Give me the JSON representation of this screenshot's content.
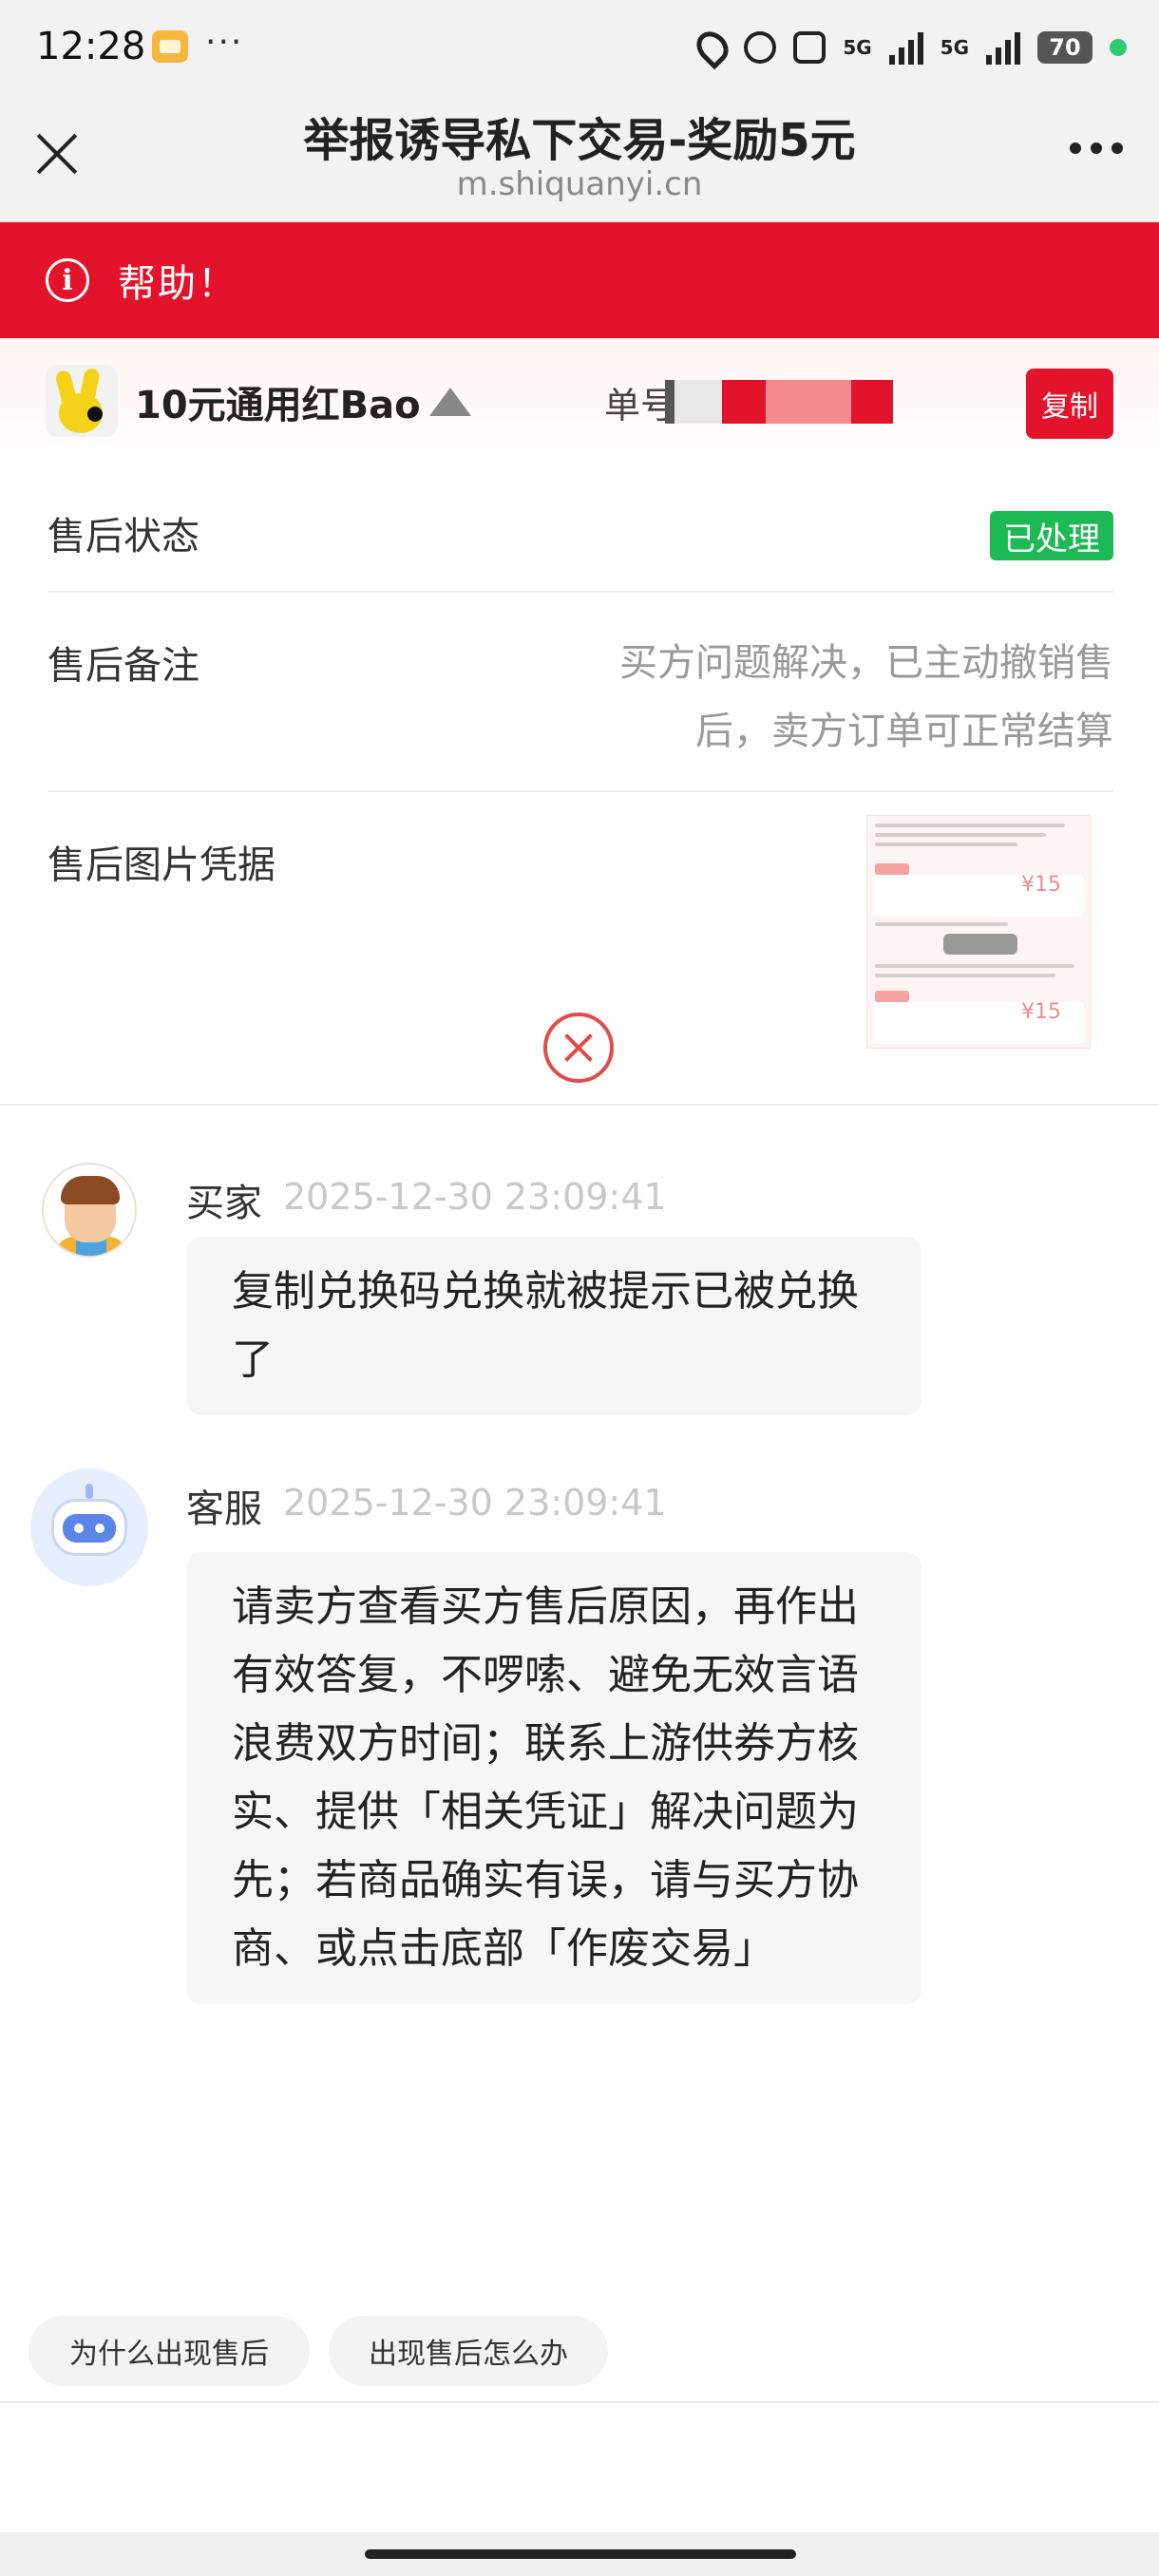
{
  "status_bar": {
    "time": "12:28",
    "dots": "···",
    "network_a": "5G",
    "network_b": "5G",
    "battery": "70"
  },
  "title_bar": {
    "title": "举报诱导私下交易-奖励5元",
    "url": "m.shiquanyi.cn"
  },
  "help_bar": {
    "icon": "i",
    "text": "帮助！"
  },
  "product": {
    "name": "10元通用红Bao",
    "order_label": "单号",
    "copy_label": "复制"
  },
  "details": {
    "status_label": "售后状态",
    "status_value": "已处理",
    "note_label": "售后备注",
    "note_value": "买方问题解决，已主动撤销售后，卖方订单可正常结算",
    "evidence_label": "售后图片凭据"
  },
  "messages": [
    {
      "sender": "买家",
      "time": "2025-12-30 23:09:41",
      "text": "复制兑换码兑换就被提示已被兑换了"
    },
    {
      "sender": "客服",
      "time": "2025-12-30 23:09:41",
      "text": "请卖方查看买方售后原因，再作出有效答复，不啰嗦、避免无效言语浪费双方时间；联系上游供券方核实、提供「相关凭证」解决问题为先；若商品确实有误，请与买方协商、或点击底部「作废交易」"
    }
  ],
  "quick_replies": [
    "为什么出现售后",
    "出现售后怎么办"
  ],
  "colors": {
    "brand_red": "#e3132b",
    "status_green": "#1db954"
  }
}
